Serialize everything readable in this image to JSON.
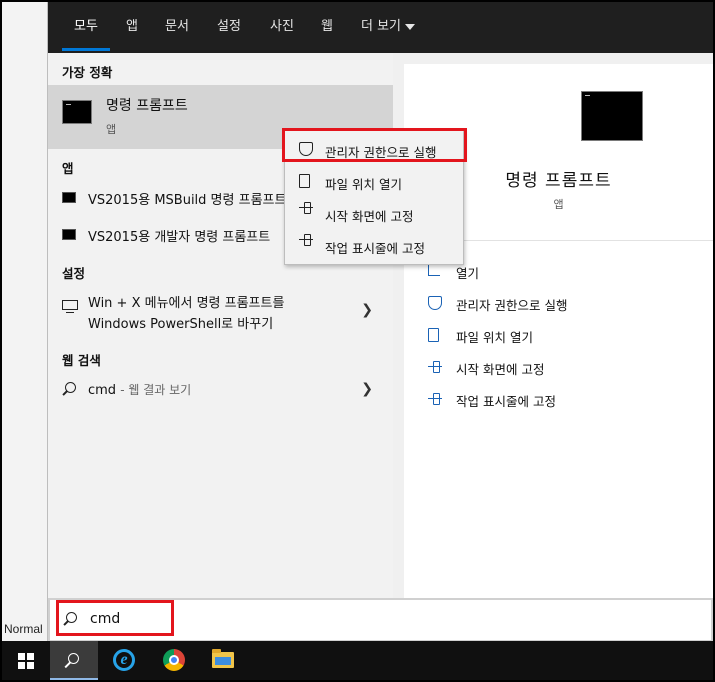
{
  "background": {
    "status_text": "Normal"
  },
  "tabs": [
    {
      "label": "모두",
      "active": true
    },
    {
      "label": "앱"
    },
    {
      "label": "문서"
    },
    {
      "label": "설정"
    },
    {
      "label": "사진"
    },
    {
      "label": "웹"
    },
    {
      "label": "더 보기"
    }
  ],
  "left": {
    "best_match_header": "가장 정확",
    "best_match": {
      "title": "명령 프롬프트",
      "subtitle": "앱"
    },
    "apps_header": "앱",
    "apps": [
      {
        "label": "VS2015용 MSBuild 명령 프롬프트"
      },
      {
        "label": "VS2015용 개발자 명령 프롬프트"
      }
    ],
    "settings_header": "설정",
    "settings_item": {
      "line1": "Win + X 메뉴에서 명령 프롬프트를",
      "line2": "Windows PowerShell로 바꾸기"
    },
    "web_header": "웹 검색",
    "web_item": {
      "query": "cmd",
      "hint": "- 웹 결과 보기"
    }
  },
  "context_menu": {
    "items": [
      {
        "label": "관리자 권한으로 실행",
        "icon": "shield-icon"
      },
      {
        "label": "파일 위치 열기",
        "icon": "folder-icon"
      },
      {
        "label": "시작 화면에 고정",
        "icon": "pin-icon"
      },
      {
        "label": "작업 표시줄에 고정",
        "icon": "pin-icon"
      }
    ]
  },
  "right": {
    "title": "명령 프롬프트",
    "subtitle": "앱",
    "actions": [
      {
        "label": "열기",
        "icon": "open-icon"
      },
      {
        "label": "관리자 권한으로 실행",
        "icon": "shield-icon"
      },
      {
        "label": "파일 위치 열기",
        "icon": "folder-icon"
      },
      {
        "label": "시작 화면에 고정",
        "icon": "pin-icon"
      },
      {
        "label": "작업 표시줄에 고정",
        "icon": "pin-icon"
      }
    ]
  },
  "search": {
    "value": "cmd"
  },
  "colors": {
    "accent": "#0078d7",
    "highlight": "#e3151d",
    "tab_bar": "#1f1f1f"
  }
}
